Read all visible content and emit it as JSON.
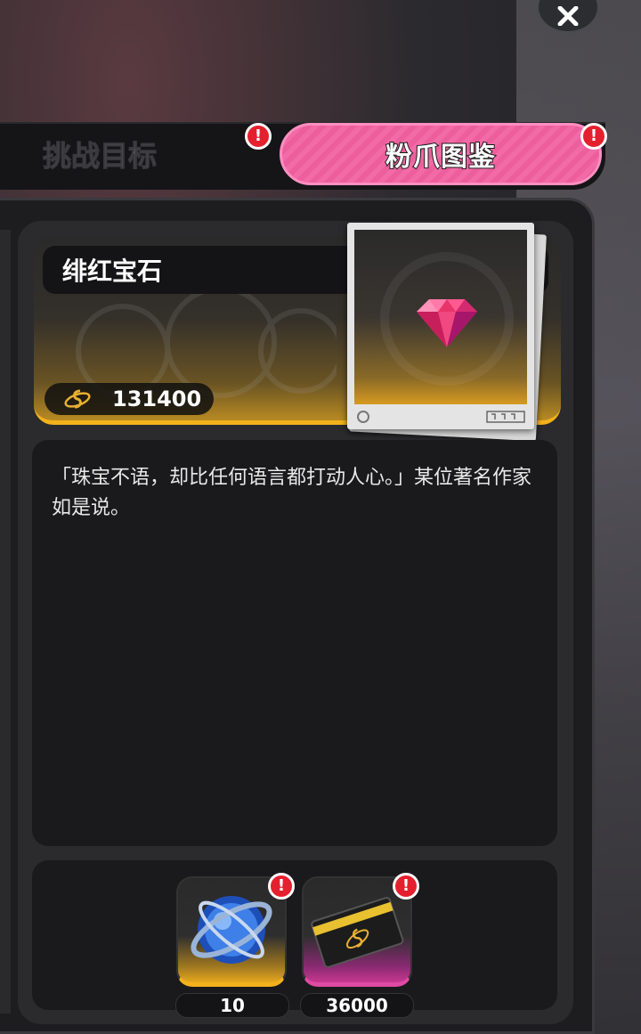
{
  "tabs": [
    {
      "label": "挑战目标",
      "active": false,
      "badge": "!"
    },
    {
      "label": "粉爪图鉴",
      "active": true,
      "badge": "!"
    }
  ],
  "item": {
    "name": "绯红宝石",
    "price": "131400",
    "description": "「珠宝不语，却比任何语言都打动人心。」某位著名作家如是说。"
  },
  "rewards": [
    {
      "icon": "blue-orb-icon",
      "count": "10",
      "badge": "!"
    },
    {
      "icon": "black-card-icon",
      "count": "36000",
      "badge": "!"
    }
  ],
  "colors": {
    "accent_pink": "#f26aa6",
    "accent_gold": "#f3b21c",
    "badge_red": "#e5202e"
  }
}
